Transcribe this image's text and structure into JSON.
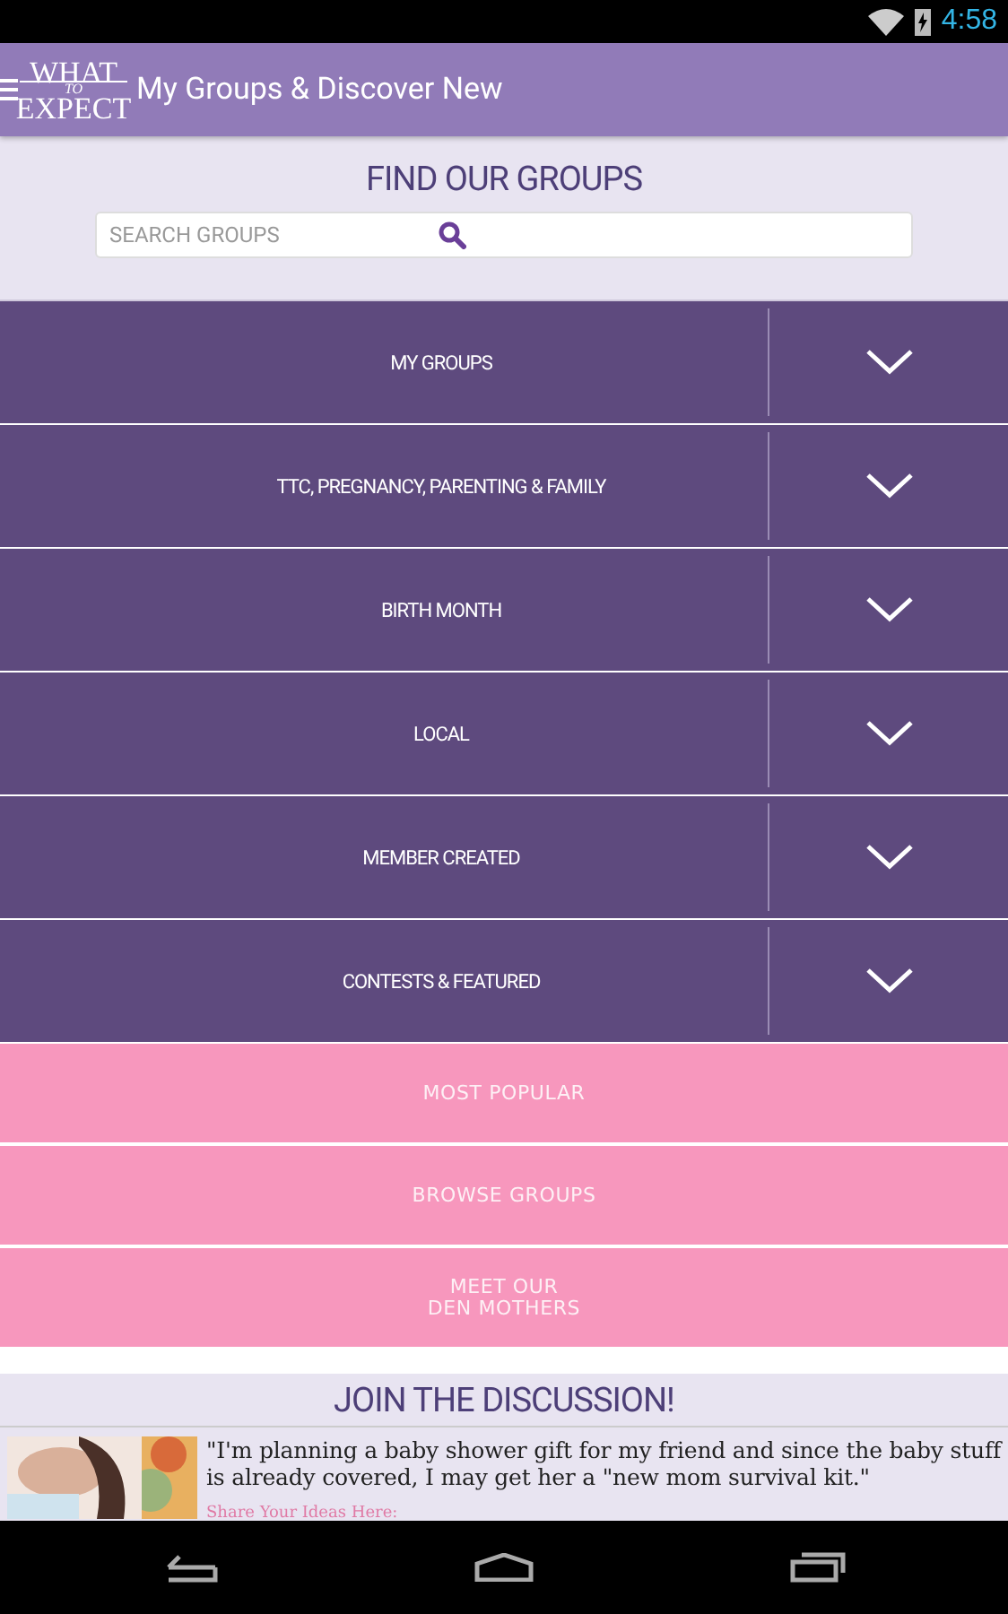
{
  "status_bar": {
    "time": "4:58"
  },
  "app_bar": {
    "logo": {
      "top": "WHAT",
      "middle": "TO",
      "bottom": "EXPECT"
    },
    "title": "My Groups & Discover New"
  },
  "find": {
    "heading": "FIND OUR GROUPS",
    "search": {
      "placeholder": "SEARCH GROUPS"
    }
  },
  "categories": [
    {
      "label": "MY GROUPS",
      "expanded": false
    },
    {
      "label": "TTC, PREGNANCY, PARENTING & FAMILY",
      "expanded": false
    },
    {
      "label": "BIRTH MONTH",
      "expanded": false
    },
    {
      "label": "LOCAL",
      "expanded": false
    },
    {
      "label": "MEMBER CREATED",
      "expanded": false
    },
    {
      "label": "CONTESTS & FEATURED",
      "expanded": false
    }
  ],
  "links": [
    {
      "lines": [
        "MOST POPULAR"
      ]
    },
    {
      "lines": [
        "BROWSE GROUPS"
      ]
    },
    {
      "lines": [
        "MEET OUR",
        "DEN MOTHERS"
      ]
    }
  ],
  "discussion": {
    "heading": "JOIN THE DISCUSSION!",
    "post": {
      "quote": "\"I'm planning a baby shower gift for my friend and since the baby stuff is already covered, I may get her a \"new mom survival kit.\"",
      "link": "Share Your Ideas Here:"
    }
  }
}
